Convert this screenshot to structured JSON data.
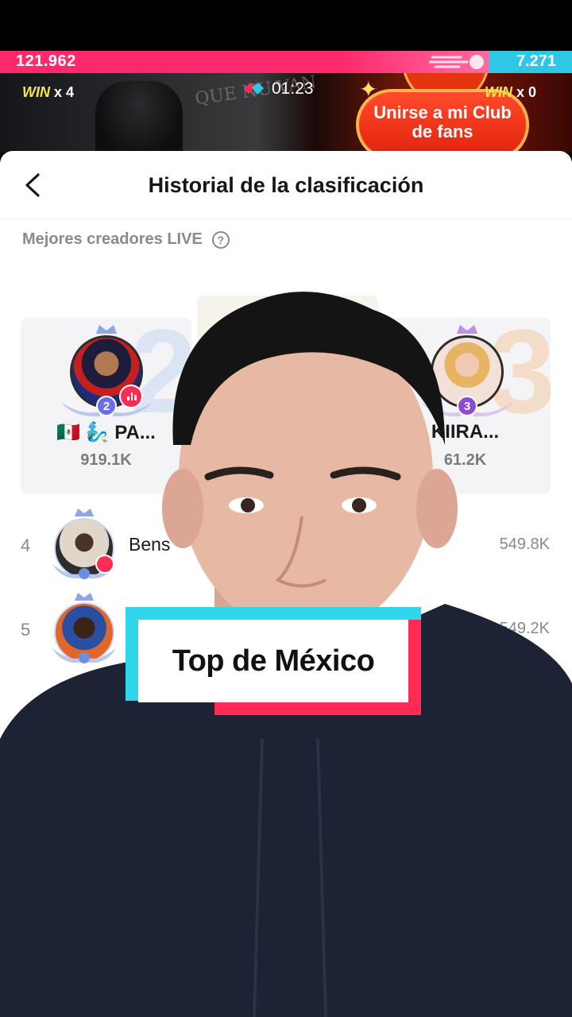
{
  "battle": {
    "score_left": "121.962",
    "score_right": "7.271",
    "left_win_word": "WIN",
    "left_win_count": "x 4",
    "right_win_word": "WIN",
    "right_win_count": "x 0",
    "timer": "01:23",
    "fan_club_line1": "Unirse a mi Club",
    "fan_club_line2": "de fans",
    "wall_text": "QUE NU VAN",
    "colors": {
      "pink": "#ff2a6d",
      "cyan": "#2dc8e6",
      "win_yellow": "#f4e64a"
    }
  },
  "panel": {
    "title": "Historial de la clasificación",
    "section_label": "Mejores creadores LIVE",
    "help_icon": "?"
  },
  "podium": [
    {
      "rank": "2",
      "name": "🇲🇽 🧞‍♂️ PA...",
      "score": "919.1K",
      "icon": "avatar"
    },
    {
      "rank": "3",
      "name": "KIIRA...",
      "score": "61.2K",
      "icon": "avatar"
    }
  ],
  "list": [
    {
      "rank": "4",
      "name": "Bens",
      "score": "549.8K"
    },
    {
      "rank": "5",
      "name": "",
      "score": "549.2K"
    }
  ],
  "caption": {
    "text": "Top de México",
    "colors": {
      "cyan": "#2fd6ec",
      "red": "#fe2c55"
    }
  }
}
